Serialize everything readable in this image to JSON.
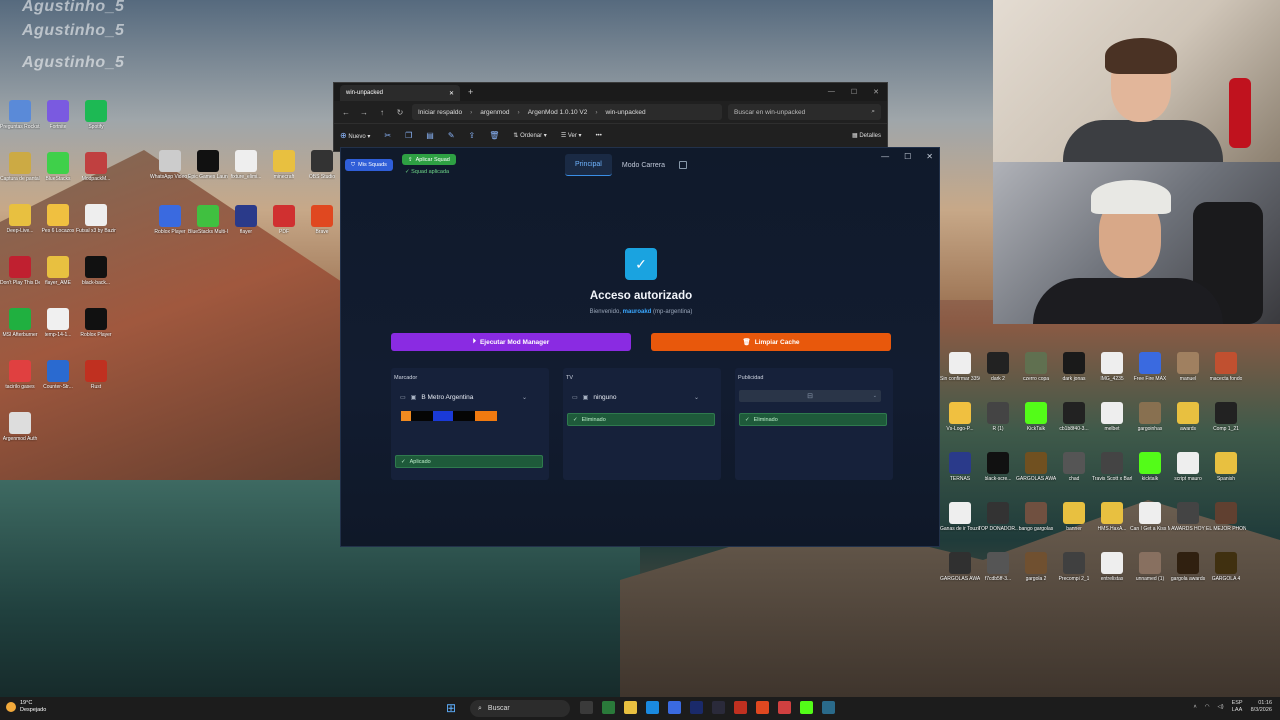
{
  "desktop": {
    "overlay_names": [
      "Agustinho_5",
      "Agustinho_5",
      "Agustinho_5"
    ],
    "left_icons": [
      {
        "label": "Preguntas Rockstar",
        "color": "#5a8ad8"
      },
      {
        "label": "Fortnite",
        "color": "#7a5ae0"
      },
      {
        "label": "Spotify",
        "color": "#1db954"
      },
      {
        "label": "Captura de pantalla",
        "color": "#ccaa44"
      },
      {
        "label": "BlueStacks",
        "color": "#3fd04a"
      },
      {
        "label": "ModpackM...",
        "color": "#c04040"
      },
      {
        "label": "Deep-Live...",
        "color": "#e8c040"
      },
      {
        "label": "Pes 6 Locazos",
        "color": "#f0c040"
      },
      {
        "label": "Futsal x3 by Bazinga frio...",
        "color": "#eeeeee"
      },
      {
        "label": "Don't Play This Demo",
        "color": "#c02030"
      },
      {
        "label": "flayer_AME",
        "color": "#e8c040"
      },
      {
        "label": "black-back...",
        "color": "#111111"
      },
      {
        "label": "MSI Afterburner",
        "color": "#20b040"
      },
      {
        "label": "temp-14-1...",
        "color": "#f0f0f0"
      },
      {
        "label": "Roblox Player",
        "color": "#111111"
      },
      {
        "label": "tacirilo gases",
        "color": "#e04040"
      },
      {
        "label": "Counter-Str...",
        "color": "#2a6ad0"
      },
      {
        "label": "Rust",
        "color": "#c03020"
      },
      {
        "label": "Argenmod Auth",
        "color": "#dddddd"
      }
    ],
    "mid_icons": [
      {
        "label": "WhatsApp Video 2025-",
        "color": "#cccccc"
      },
      {
        "label": "Epic Games Launcher",
        "color": "#111111"
      },
      {
        "label": "fixture_elimi...",
        "color": "#eeeeee"
      },
      {
        "label": "minecraft",
        "color": "#e8c040"
      },
      {
        "label": "OBS Studio",
        "color": "#333333"
      },
      {
        "label": "Roblox Player",
        "color": "#3a6ae0"
      },
      {
        "label": "BlueStacks Multi-Insta...",
        "color": "#40c040"
      },
      {
        "label": "flayer",
        "color": "#2a3a8a"
      },
      {
        "label": "PDF",
        "color": "#d03030"
      },
      {
        "label": "Brave",
        "color": "#e04820"
      }
    ],
    "right_icons": [
      {
        "label": "Sin confirmar 335677...",
        "color": "#eeeeee"
      },
      {
        "label": "dark 2",
        "color": "#222222"
      },
      {
        "label": "czerro copa",
        "color": "#607050"
      },
      {
        "label": "dark jonas",
        "color": "#1a1a1a"
      },
      {
        "label": "IMG_4235",
        "color": "#eeeeee"
      },
      {
        "label": "Free Fire MAX",
        "color": "#3a6ae0"
      },
      {
        "label": "manuel",
        "color": "#a08060"
      },
      {
        "label": "macecta fondo",
        "color": "#c05030"
      },
      {
        "label": "Vs-Logo-P...",
        "color": "#f0c040"
      },
      {
        "label": "R (1)",
        "color": "#444444"
      },
      {
        "label": "KickTalk",
        "color": "#53fc18"
      },
      {
        "label": "cb1b8f40-3...",
        "color": "#222222"
      },
      {
        "label": "melbet",
        "color": "#eeeeee"
      },
      {
        "label": "gargoinhas",
        "color": "#887050"
      },
      {
        "label": "awards",
        "color": "#e8c040"
      },
      {
        "label": "Comp 1_21",
        "color": "#222222"
      },
      {
        "label": "TERNAS",
        "color": "#2a3a8a"
      },
      {
        "label": "black-scre...",
        "color": "#111111"
      },
      {
        "label": "GARGOLAS AWARDS",
        "color": "#705020"
      },
      {
        "label": "chad",
        "color": "#555555"
      },
      {
        "label": "Travis Scott x Barbi",
        "color": "#444444"
      },
      {
        "label": "kicktalk",
        "color": "#53fc18"
      },
      {
        "label": "script mauro",
        "color": "#eeeeee"
      },
      {
        "label": "Spanish",
        "color": "#e8c040"
      },
      {
        "label": "Ganas de ir Touze (Ak...",
        "color": "#eeeeee"
      },
      {
        "label": "TOP DONADOR...",
        "color": "#333333"
      },
      {
        "label": "bango gargolas",
        "color": "#705040"
      },
      {
        "label": "banner",
        "color": "#e8c040"
      },
      {
        "label": "HMS.HaxA...",
        "color": "#e8c040"
      },
      {
        "label": "Can I Get a Kiss Mauroo",
        "color": "#eeeeee"
      },
      {
        "label": "AWARDS HOY",
        "color": "#444444"
      },
      {
        "label": "EL MEJOR PHONK",
        "color": "#604030"
      },
      {
        "label": "GARGOLAS AWARSD",
        "color": "#303030"
      },
      {
        "label": "f7cdb5ff-3...",
        "color": "#555555"
      },
      {
        "label": "gargola 2",
        "color": "#705030"
      },
      {
        "label": "Precompi 2_1",
        "color": "#404040"
      },
      {
        "label": "entrelistas",
        "color": "#eeeeee"
      },
      {
        "label": "unnamed (1)",
        "color": "#887060"
      },
      {
        "label": "gargola awards",
        "color": "#302010"
      },
      {
        "label": "GARGOLA 4",
        "color": "#403010"
      }
    ]
  },
  "explorer": {
    "tab_title": "win-unpacked",
    "breadcrumbs": [
      "Iniciar respaldo",
      "argenmod",
      "ArgenMod 1.0.10 V2",
      "win-unpacked"
    ],
    "search_placeholder": "Buscar en win-unpacked",
    "cmd_new": "Nuevo",
    "cmd_sort": "Ordenar",
    "cmd_view": "Ver",
    "cmd_details": "Detalles"
  },
  "app": {
    "squads_button": "Mis Squads",
    "apply_squad_button": "Aplicar Squad",
    "squad_applied_note": "Squad aplicada",
    "tabs": [
      "Principal",
      "Modo Carrera"
    ],
    "title": "Acceso autorizado",
    "welcome_prefix": "Bienvenido,",
    "username": "mauroakd",
    "user_tag": "(mp-argentina)",
    "run_button": "Ejecutar Mod Manager",
    "clear_cache_button": "Limpiar Cache",
    "panels": {
      "marcador": {
        "title": "Marcador",
        "selected": "B Metro Argentina",
        "status": "Aplicado"
      },
      "tv": {
        "title": "TV",
        "selected": "ninguno",
        "status": "Eliminado"
      },
      "publicidad": {
        "title": "Publicidad",
        "status": "Eliminado"
      }
    },
    "colors": {
      "run": "#8a2be2",
      "clear": "#e8580c",
      "accent": "#1aa3e0",
      "success": "#2ea043"
    }
  },
  "taskbar": {
    "weather_temp": "19°C",
    "weather_desc": "Despejado",
    "search_label": "Buscar",
    "lang_line1": "ESP",
    "lang_line2": "LAA",
    "time": "01:16",
    "date": "8/3/2026"
  }
}
